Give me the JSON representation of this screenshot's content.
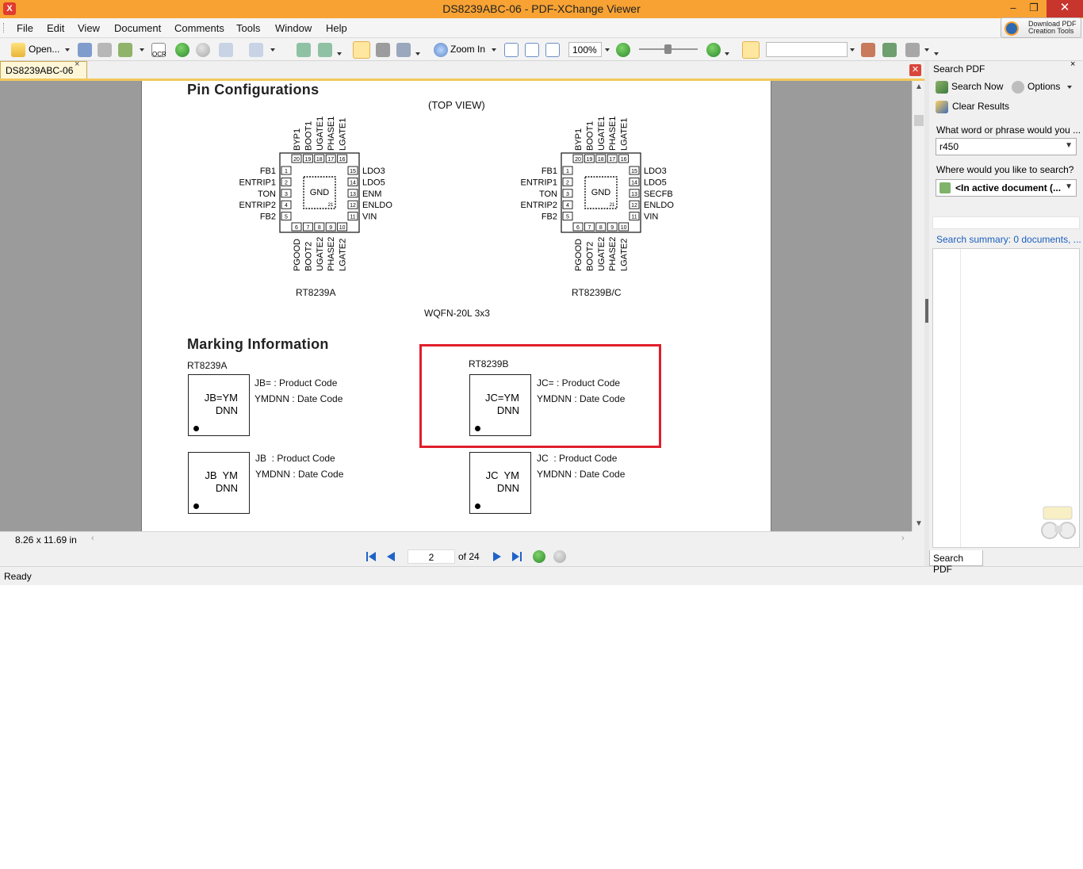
{
  "window": {
    "title": "DS8239ABC-06 - PDF-XChange Viewer",
    "app_icon": "X",
    "minimize": "–",
    "restore": "❐",
    "close": "✕"
  },
  "menu": [
    "File",
    "Edit",
    "View",
    "Document",
    "Comments",
    "Tools",
    "Window",
    "Help"
  ],
  "download_tools": {
    "line1": "Download PDF",
    "line2": "Creation Tools"
  },
  "toolbar": {
    "open_label": "Open...",
    "ocr_label": "OCR",
    "zoom_in_label": "Zoom In",
    "zoom_value": "100%"
  },
  "doc_tab": {
    "label": "DS8239ABC-06",
    "close": "×"
  },
  "pdf": {
    "pin_title": "Pin Configurations",
    "top_view": "(TOP VIEW)",
    "chipA": {
      "name": "RT8239A",
      "top_pins": [
        "BYP1",
        "BOOT1",
        "UGATE1",
        "PHASE1",
        "LGATE1"
      ],
      "top_nums": [
        "20",
        "19",
        "18",
        "17",
        "16"
      ],
      "left_pins": [
        "FB1",
        "ENTRIP1",
        "TON",
        "ENTRIP2",
        "FB2"
      ],
      "left_nums": [
        "1",
        "2",
        "3",
        "4",
        "5"
      ],
      "right_pins": [
        "LDO3",
        "LDO5",
        "ENM",
        "ENLDO",
        "VIN"
      ],
      "right_nums": [
        "15",
        "14",
        "13",
        "12",
        "11"
      ],
      "bottom_pins": [
        "PGOOD",
        "BOOT2",
        "UGATE2",
        "PHASE2",
        "LGATE2"
      ],
      "bottom_nums": [
        "6",
        "7",
        "8",
        "9",
        "10"
      ],
      "gnd": "GND",
      "gnd_num": "21"
    },
    "chipB": {
      "name": "RT8239B/C",
      "top_pins": [
        "BYP1",
        "BOOT1",
        "UGATE1",
        "PHASE1",
        "LGATE1"
      ],
      "top_nums": [
        "20",
        "19",
        "18",
        "17",
        "16"
      ],
      "left_pins": [
        "FB1",
        "ENTRIP1",
        "TON",
        "ENTRIP2",
        "FB2"
      ],
      "left_nums": [
        "1",
        "2",
        "3",
        "4",
        "5"
      ],
      "right_pins": [
        "LDO3",
        "LDO5",
        "SECFB",
        "ENLDO",
        "VIN"
      ],
      "right_nums": [
        "15",
        "14",
        "13",
        "12",
        "11"
      ],
      "bottom_pins": [
        "PGOOD",
        "BOOT2",
        "UGATE2",
        "PHASE2",
        "LGATE2"
      ],
      "bottom_nums": [
        "6",
        "7",
        "8",
        "9",
        "10"
      ],
      "gnd": "GND",
      "gnd_num": "21"
    },
    "package": "WQFN-20L 3x3",
    "marking_title": "Marking Information",
    "markA_label": "RT8239A",
    "markB_label": "RT8239B",
    "box1": {
      "l1": "JB=YM",
      "l2": "DNN",
      "desc1": "JB= : Product Code",
      "desc2": "YMDNN : Date Code"
    },
    "box2": {
      "l1": "JC=YM",
      "l2": "DNN",
      "desc1": "JC= : Product Code",
      "desc2": "YMDNN : Date Code"
    },
    "box3": {
      "l1": "JB  YM",
      "l2": "DNN",
      "desc1": "JB  : Product Code",
      "desc2": "YMDNN : Date Code"
    },
    "box4": {
      "l1": "JC  YM",
      "l2": "DNN",
      "desc1": "JC  : Product Code",
      "desc2": "YMDNN : Date Code"
    }
  },
  "page_size": "8.26 x 11.69 in",
  "nav": {
    "current_page": "2",
    "of_pages": "of 24"
  },
  "status": "Ready",
  "search_panel": {
    "title": "Search PDF",
    "close": "×",
    "search_now": "Search Now",
    "options": "Options",
    "clear_results": "Clear Results",
    "question1": "What word or phrase would you ...",
    "query": "r450",
    "question2": "Where would you like to search?",
    "scope": "<In active document (...",
    "summary": "Search summary: 0 documents, ...",
    "tab_label": "Search PDF"
  },
  "colors": {
    "titlebar": "#f7a233",
    "highlight": "#e01e2b",
    "link": "#1a5fbf"
  }
}
